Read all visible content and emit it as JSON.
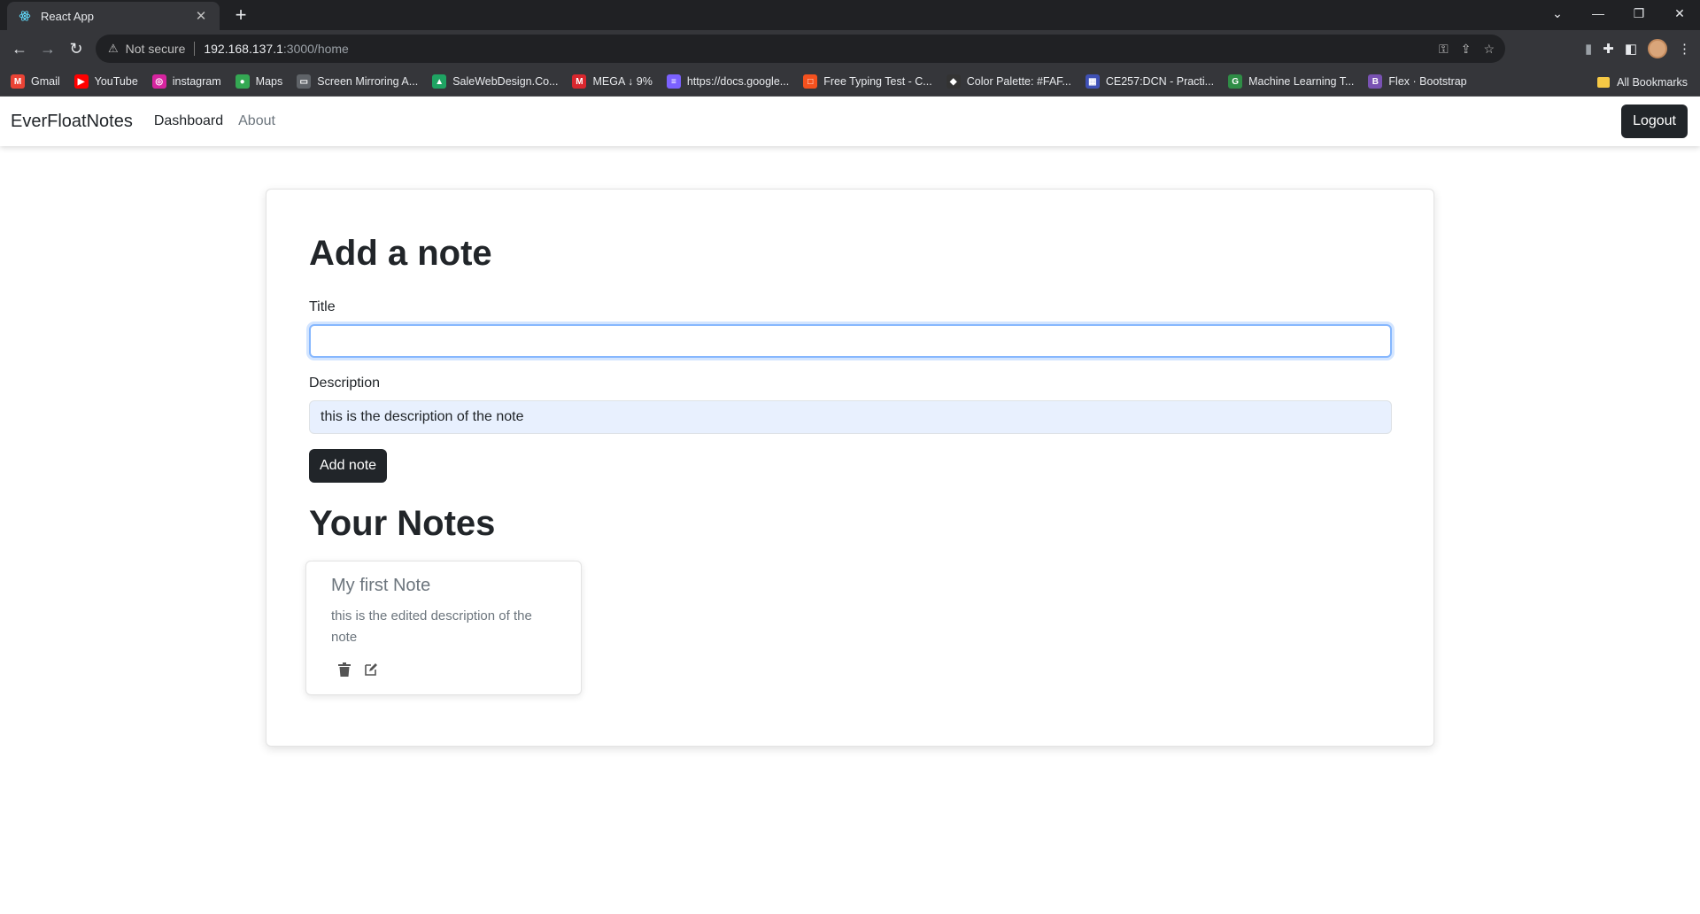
{
  "browser": {
    "tab_title": "React App",
    "tab_close": "✕",
    "new_tab": "+",
    "not_secure": "Not secure",
    "url_host": "192.168.137.1",
    "url_path": ":3000/home",
    "bookmarks": [
      {
        "label": "Gmail",
        "icon": "gmail-icon",
        "color": "#ea4335",
        "glyph": "M"
      },
      {
        "label": "YouTube",
        "icon": "youtube-icon",
        "color": "#ff0000",
        "glyph": "▶"
      },
      {
        "label": "instagram",
        "icon": "instagram-icon",
        "color": "#d6249f",
        "glyph": "◎"
      },
      {
        "label": "Maps",
        "icon": "maps-icon",
        "color": "#34a853",
        "glyph": "●"
      },
      {
        "label": "Screen Mirroring A...",
        "icon": "screen-mirroring-icon",
        "color": "#5f6368",
        "glyph": "▭"
      },
      {
        "label": "SaleWebDesign.Co...",
        "icon": "google-drive-icon",
        "color": "#1fa463",
        "glyph": "▲"
      },
      {
        "label": "MEGA ↓ 9%",
        "icon": "mega-icon",
        "color": "#d9272e",
        "glyph": "M"
      },
      {
        "label": "https://docs.google...",
        "icon": "google-docs-icon",
        "color": "#7b61ff",
        "glyph": "≡"
      },
      {
        "label": "Free Typing Test - C...",
        "icon": "typing-test-icon",
        "color": "#f4511e",
        "glyph": "□"
      },
      {
        "label": "Color Palette: #FAF...",
        "icon": "color-palette-icon",
        "color": "#333333",
        "glyph": "◆"
      },
      {
        "label": "CE257:DCN - Practi...",
        "icon": "ce257-icon",
        "color": "#3f51b5",
        "glyph": "▦"
      },
      {
        "label": "Machine Learning T...",
        "icon": "geeksforgeeks-icon",
        "color": "#2f8d46",
        "glyph": "G"
      },
      {
        "label": "Flex · Bootstrap",
        "icon": "bootstrap-icon",
        "color": "#7952b3",
        "glyph": "B"
      }
    ],
    "all_bookmarks": "All Bookmarks"
  },
  "navbar": {
    "brand": "EverFloatNotes",
    "links": [
      "Dashboard",
      "About"
    ],
    "logout": "Logout"
  },
  "form": {
    "heading": "Add a note",
    "title_label": "Title",
    "title_value": "",
    "description_label": "Description",
    "description_value": "this is the description of the note",
    "submit": "Add note"
  },
  "notes": {
    "heading": "Your Notes",
    "items": [
      {
        "title": "My first Note",
        "description": "this is the edited description of the note"
      }
    ]
  },
  "colors": {
    "dark_button": "#212529",
    "muted_text": "#6c757d",
    "focus_border": "#86b7fe",
    "autofill_bg": "#e8f0fe"
  }
}
